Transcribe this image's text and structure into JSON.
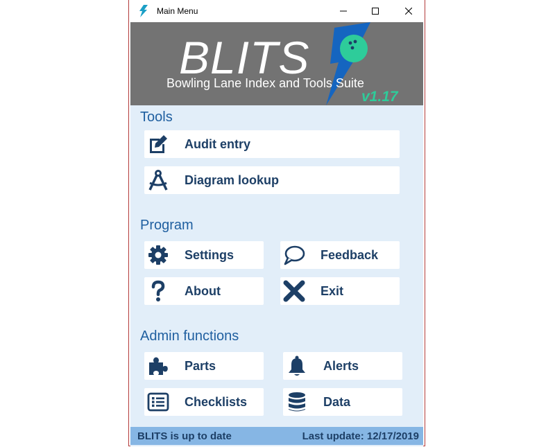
{
  "window": {
    "title": "Main Menu"
  },
  "banner": {
    "title": "BLITS",
    "subtitle": "Bowling Lane Index and Tools Suite",
    "version": "v1.17"
  },
  "sections": {
    "tools": "Tools",
    "program": "Program",
    "admin": "Admin functions"
  },
  "buttons": {
    "audit_entry": "Audit entry",
    "diagram_lookup": "Diagram lookup",
    "settings": "Settings",
    "feedback": "Feedback",
    "about": "About",
    "exit": "Exit",
    "parts": "Parts",
    "alerts": "Alerts",
    "checklists": "Checklists",
    "data": "Data"
  },
  "status": {
    "left": "BLITS is up to date",
    "right": "Last update: 12/17/2019"
  },
  "colors": {
    "accent": "#1d3f66",
    "section": "#1f5fa0",
    "background": "#e2eef9",
    "status_bar": "#86b6e4",
    "bolt": "#1565c0",
    "version": "#2ecc9a"
  }
}
